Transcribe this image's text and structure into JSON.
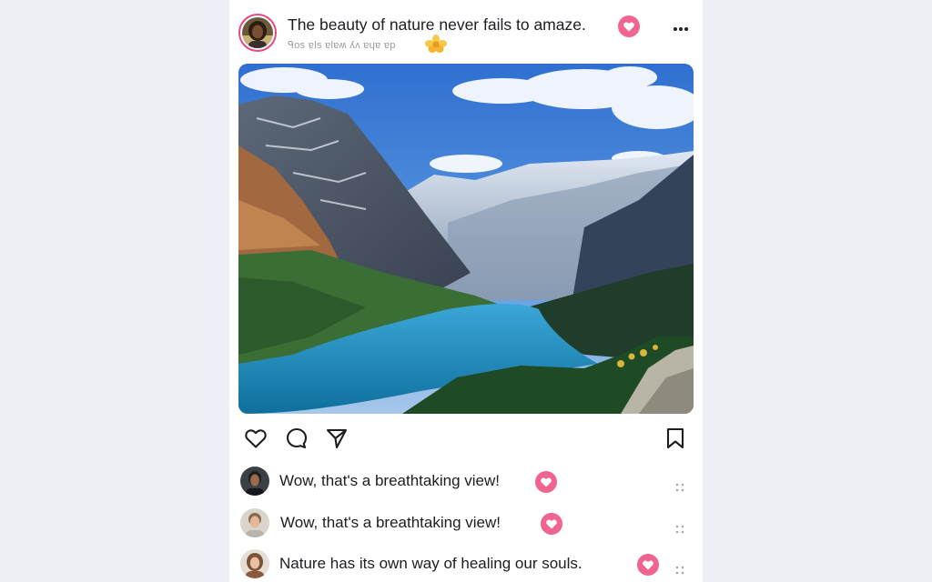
{
  "post": {
    "title": "The beauty of nature never fails to amaze.",
    "subtitle": "ᑫos ɐls ɐlɐʍ ʎʌ ɐɥɐ ɐp",
    "accent_color": "#e64980",
    "heart_color": "#f06590",
    "author_avatar_icon": "user-avatar",
    "menu_icon": "more-dots-icon"
  },
  "actions": {
    "like_icon": "heart-outline-icon",
    "comment_icon": "comment-bubble-icon",
    "share_icon": "send-paper-plane-icon",
    "save_icon": "bookmark-icon"
  },
  "comments": [
    {
      "text": "Wow, that's a breathtaking view!"
    },
    {
      "text": "Wow, that's a breathtaking view!"
    },
    {
      "text": "Nature has its own way of healing our souls."
    }
  ]
}
